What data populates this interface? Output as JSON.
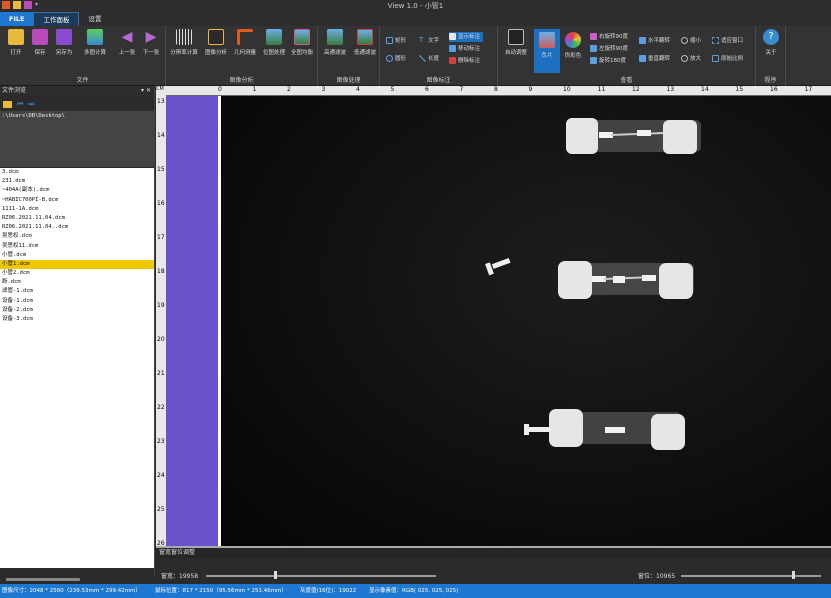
{
  "window": {
    "title": "View 1.0 - 小管1"
  },
  "tabs": [
    "FILE",
    "工作面板",
    "设置"
  ],
  "ribbon": {
    "file_group": {
      "label": "文件",
      "buttons": [
        "打开",
        "保存",
        "另存为",
        "多图计算",
        "上一张",
        "下一张"
      ]
    },
    "analysis_group": {
      "label": "图像分析",
      "buttons": [
        "分辨率计算",
        "图像分析",
        "几何测量",
        "位图处理",
        "全图均衡"
      ]
    },
    "process_group": {
      "label": "图像处理",
      "buttons": [
        "高通滤波",
        "低通滤波"
      ]
    },
    "annot_group": {
      "label": "图像标注",
      "buttons": [
        "矩形",
        "圆形",
        "文字",
        "长度",
        "显示标注",
        "移动标注",
        "删除标注"
      ]
    },
    "view_group": {
      "label": "查看",
      "buttons": [
        "自动调整",
        "负片",
        "伪彩色",
        "右旋转90度",
        "左旋转90度",
        "旋转180度",
        "水平翻转",
        "垂直翻转",
        "缩小",
        "放大",
        "适应窗口",
        "原始比例"
      ]
    },
    "app_group": {
      "label": "程序",
      "buttons": [
        "关于"
      ]
    }
  },
  "file_panel": {
    "title": "文件浏览",
    "path": ":\\Users\\DB\\Desktop\\",
    "files": [
      "3.dcm",
      "231.dcm",
      "~404A(副本).dcm",
      "~HABIC700PI-B.dcm",
      "1111-1A.dcm",
      "RZ06.2021.11.04.dcm",
      "RZ06.2021.11.04..dcm",
      "吴思权.dcm",
      "吴思权11.dcm",
      "小管.dcm",
      "小管1.dcm",
      "小管2.dcm",
      "断.dcm",
      "滤管-1.dcm",
      "设备-1.dcm",
      "设备-2.dcm",
      "设备-3.dcm"
    ],
    "selected_index": 10
  },
  "viewer": {
    "corner_label": "CM",
    "top_ruler": [
      "0",
      "1",
      "2",
      "3",
      "4",
      "5",
      "6",
      "7",
      "8",
      "9",
      "10",
      "11",
      "12",
      "13",
      "14",
      "15",
      "16",
      "17"
    ],
    "left_ruler": [
      "13",
      "14",
      "15",
      "16",
      "17",
      "18",
      "19",
      "20",
      "21",
      "22",
      "23",
      "24",
      "25",
      "26"
    ]
  },
  "window_panel": {
    "title": "窗宽窗位调整",
    "width_label": "窗宽：19958",
    "level_label": "窗位：10965",
    "width_fraction": 0.3,
    "level_fraction": 0.8
  },
  "status": {
    "image_size": "图像尺寸：2048 * 2560（239.53mm * 299.42mm）",
    "mouse_pos": "鼠标位置：817 * 2150（95.56mm * 251.46mm）",
    "gray": "灰度值(16位)：19022",
    "display": "显示像素值：RGB( 025, 025, 025)"
  },
  "colors": {
    "accent": "#1e78d2",
    "panel": "#2b2b2b",
    "selected_file": "#f0c800",
    "mask": "#6a52cc"
  }
}
